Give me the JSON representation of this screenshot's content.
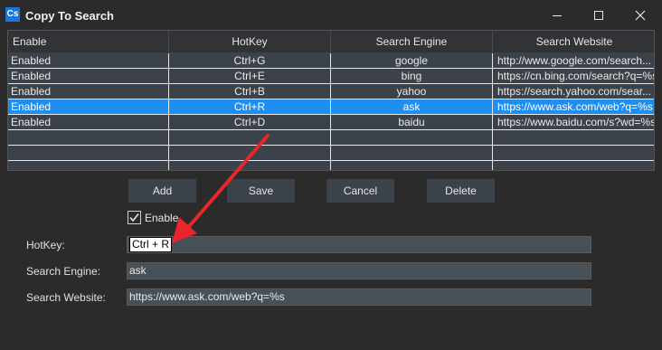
{
  "window": {
    "title": "Copy To Search",
    "icon_text": "Cs"
  },
  "grid": {
    "columns": [
      "Enable",
      "HotKey",
      "Search Engine",
      "Search Website"
    ],
    "rows": [
      {
        "enable": "Enabled",
        "hotkey": "Ctrl+G",
        "engine": "google",
        "website": "http://www.google.com/search..."
      },
      {
        "enable": "Enabled",
        "hotkey": "Ctrl+E",
        "engine": "bing",
        "website": "https://cn.bing.com/search?q=%s"
      },
      {
        "enable": "Enabled",
        "hotkey": "Ctrl+B",
        "engine": "yahoo",
        "website": "https://search.yahoo.com/sear..."
      },
      {
        "enable": "Enabled",
        "hotkey": "Ctrl+R",
        "engine": "ask",
        "website": "https://www.ask.com/web?q=%s"
      },
      {
        "enable": "Enabled",
        "hotkey": "Ctrl+D",
        "engine": "baidu",
        "website": "https://www.baidu.com/s?wd=%s"
      }
    ],
    "selected_row": 3
  },
  "buttons": {
    "add": "Add",
    "save": "Save",
    "cancel": "Cancel",
    "delete": "Delete"
  },
  "form": {
    "enable_label": "Enable",
    "enable_checked": true,
    "hotkey_label": "HotKey:",
    "hotkey_value": "Ctrl + R",
    "engine_label": "Search Engine:",
    "engine_value": "ask",
    "website_label": "Search Website:",
    "website_value": "https://www.ask.com/web?q=%s"
  },
  "colors": {
    "selection": "#1e8ff0",
    "annotation_arrow": "#e8262b"
  }
}
